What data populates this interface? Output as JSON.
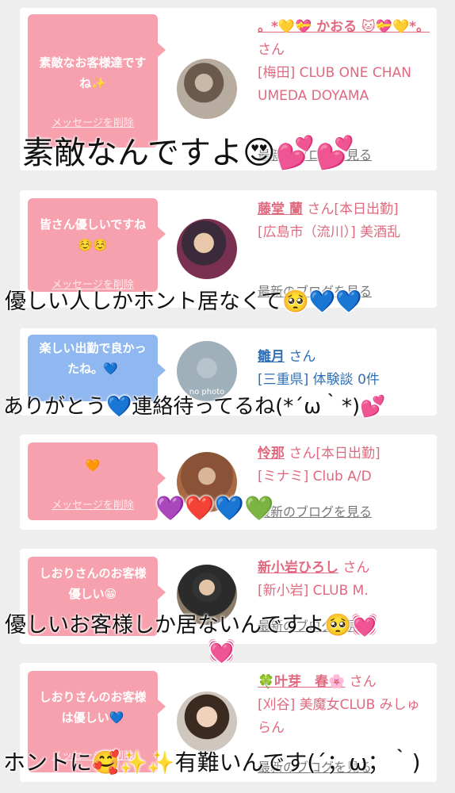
{
  "delete_label": "メッセージを削除",
  "blog_label": "最新のブログを見る",
  "san": "さん",
  "cards": [
    {
      "message": "素敵なお客様達ですね✨",
      "name": "。*💛💝 かおる 🐱💝💛*。",
      "suffix": "さん",
      "area": "[梅田] CLUB ONE CHAN UMEDA DOYAMA",
      "avatar": "avatar-photo-mirror-selfie"
    },
    {
      "message": "皆さん優しいですね☺️☺️",
      "name": "藤堂 蘭",
      "suffix": "さん[本日出勤]",
      "area": "[広島市（流川）] 美酒乱",
      "avatar": "avatar-photo-kimono"
    },
    {
      "message": "楽しい出勤で良かったね。💙",
      "name": "雛月",
      "suffix": "さん",
      "area": "[三重県] 体験談 0件",
      "avatar": "no photo"
    },
    {
      "message": "🧡",
      "name": "怜那",
      "suffix": "さん[本日出勤]",
      "area": "[ミナミ] Club A/D",
      "avatar": "avatar-photo-hair"
    },
    {
      "message": "しおりさんのお客様優しい😁",
      "name": "新小岩ひろし",
      "suffix": "さん",
      "area": "[新小岩] CLUB M.",
      "avatar": "avatar-photo-man-suit"
    },
    {
      "message": "しおりさんのお客様は優しい💙",
      "name": "🍀叶芽　春🌸",
      "suffix": "さん",
      "area": "[刈谷] 美魔女CLUB みしゅらん",
      "avatar": "avatar-photo-woman"
    }
  ],
  "overlays": {
    "o1": "素敵なんですよ😍💕💕",
    "o2": "優しい人しかホント居なくて🥺💙💙",
    "o3": "ありがとう💙連絡待ってるね(*´ω｀*)💕",
    "o4": "💜❤️💙💚",
    "o5": "優しいお客様しか居ないんですよ🥺💓",
    "o5b": "💓",
    "o6": "ホントに🥰✨✨有難いんです(´；ω；｀)"
  },
  "colors": {
    "bubble_pink": "#f7a1ae",
    "bubble_blue": "#8fb7f0",
    "name_pink": "#e0697f",
    "name_blue": "#2f6fb5"
  }
}
